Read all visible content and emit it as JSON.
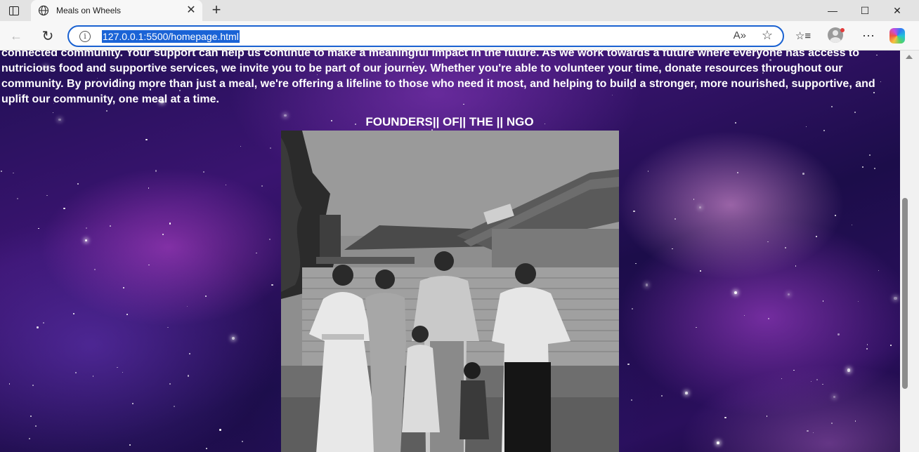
{
  "browser": {
    "tab_title": "Meals on Wheels",
    "url": "127.0.0.1:5500/homepage.html",
    "icons": {
      "tab_actions": "tab-actions-icon",
      "site": "globe-icon",
      "close_tab": "close-icon",
      "new_tab": "plus-icon",
      "back": "back-arrow-icon",
      "refresh": "refresh-icon",
      "site_info": "info-icon",
      "read_aloud": "read-aloud-icon",
      "favorite": "star-icon",
      "favorites": "favorites-icon",
      "profile": "profile-icon",
      "more": "more-icon",
      "copilot": "copilot-icon"
    },
    "glyphs": {
      "close_tab": "✕",
      "new_tab": "+",
      "back": "←",
      "refresh": "↻",
      "site_info": "i",
      "read_aloud": "A»",
      "favorite": "☆",
      "favorites": "☆≡",
      "more": "⋯",
      "minimize": "—",
      "maximize": "☐",
      "close_window": "✕"
    },
    "accent_color": "#1a62d1"
  },
  "page": {
    "intro_text": "connected community. Your support can help us continue to make a meaningful impact in the future. As we work towards a future where everyone has access to nutricious food and supportive services, we invite you to be part of our journey. Whether you're able to volunteer your time, donate resources throughout our community. By providing more than just a meal, we're offering a lifeline to those who need it most, and helping to build a stronger, more nourished, supportive, and uplift our community, one meal at a time.",
    "founders_heading": "FOUNDERS|| OF|| THE || NGO",
    "background": "galaxy-nebula-background",
    "photo": "founders-group-photo"
  }
}
